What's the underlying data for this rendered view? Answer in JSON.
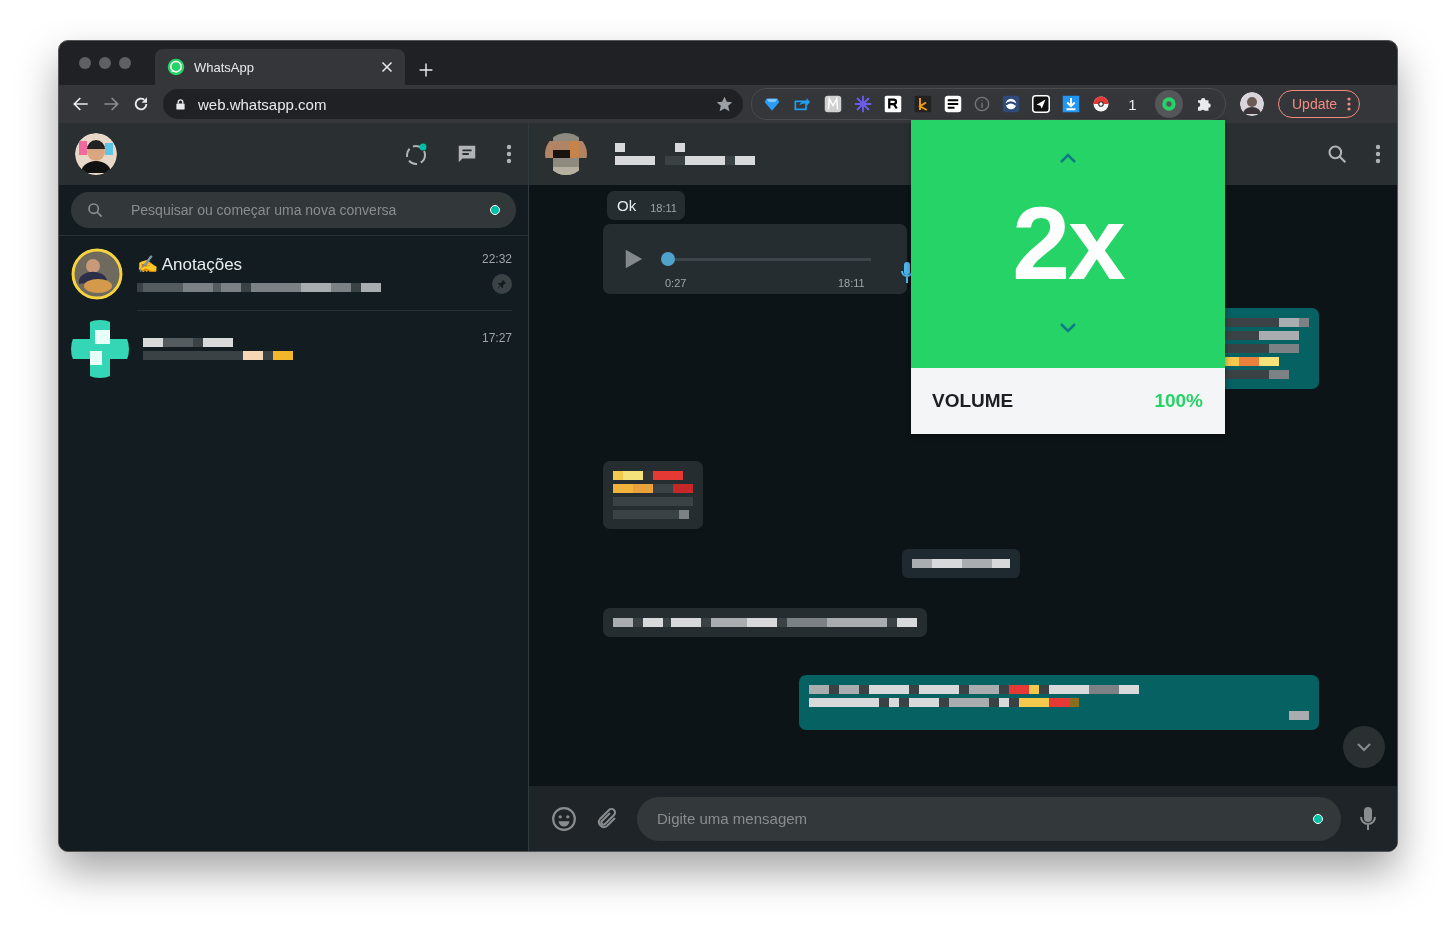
{
  "browser": {
    "tab_title": "WhatsApp",
    "url": "web.whatsapp.com",
    "extension_badge": "1",
    "update_button": "Update"
  },
  "sidebar": {
    "search": {
      "placeholder": "Pesquisar ou começar uma nova conversa"
    },
    "chats": [
      {
        "name": "✍️ Anotações",
        "time": "22:32",
        "pinned": true
      },
      {
        "time": "17:27",
        "pinned": false
      }
    ]
  },
  "chat": {
    "messages": [
      {
        "kind": "text",
        "outgoing": false,
        "text": "Ok",
        "time": "18:11"
      },
      {
        "kind": "voice",
        "outgoing": false,
        "duration": "0:27",
        "time": "18:11",
        "level": 0
      },
      {
        "kind": "redacted",
        "outgoing": true
      },
      {
        "kind": "redacted",
        "outgoing": false
      },
      {
        "kind": "chip"
      },
      {
        "kind": "redacted",
        "outgoing": false
      },
      {
        "kind": "redacted",
        "outgoing": true
      }
    ],
    "composer": {
      "placeholder": "Digite uma mensagem"
    }
  },
  "speed_popup": {
    "speed": "2x",
    "volume_label": "VOLUME",
    "volume_value": "100%"
  }
}
